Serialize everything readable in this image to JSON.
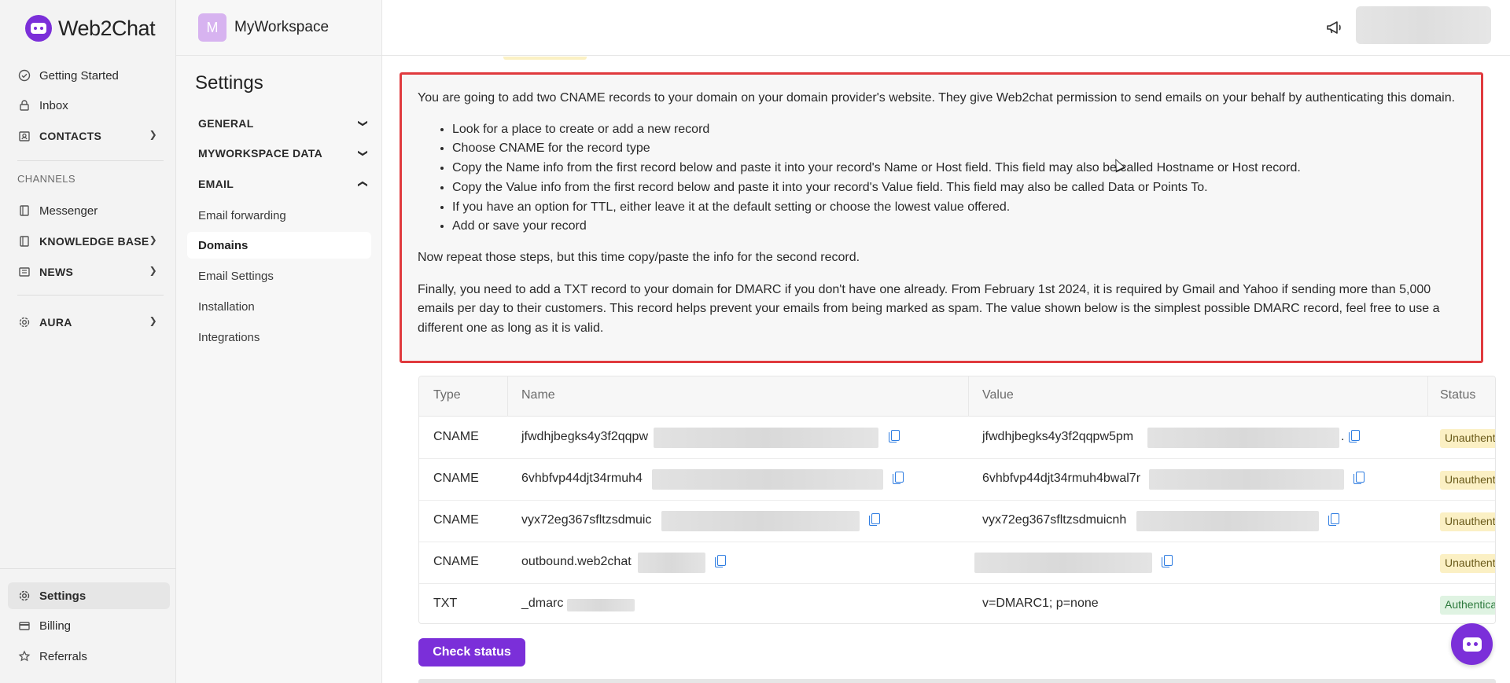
{
  "app": {
    "logo_text": "Web2Chat"
  },
  "leftnav": {
    "items_top": [
      {
        "label": "Getting Started",
        "icon": "check-circle-icon"
      },
      {
        "label": "Inbox",
        "icon": "lock-icon"
      },
      {
        "label": "CONTACTS",
        "icon": "contacts-icon"
      }
    ],
    "channels_label": "CHANNELS",
    "items_channels": [
      {
        "label": "Messenger",
        "icon": "book-icon"
      },
      {
        "label": "KNOWLEDGE BASE",
        "icon": "book-icon"
      },
      {
        "label": "NEWS",
        "icon": "news-icon"
      }
    ],
    "aura": {
      "label": "AURA",
      "icon": "gear-icon"
    },
    "items_bottom": [
      {
        "label": "Settings",
        "icon": "gear-icon"
      },
      {
        "label": "Billing",
        "icon": "card-icon"
      },
      {
        "label": "Referrals",
        "icon": "star-icon"
      }
    ]
  },
  "workspace": {
    "avatar_letter": "M",
    "name": "MyWorkspace"
  },
  "settings": {
    "title": "Settings",
    "groups": [
      {
        "label": "GENERAL"
      },
      {
        "label": "MYWORKSPACE DATA"
      },
      {
        "label": "EMAIL"
      }
    ],
    "email_items": [
      "Email forwarding",
      "Domains",
      "Email Settings"
    ],
    "other_items": [
      "Installation",
      "Integrations"
    ]
  },
  "info": {
    "intro": "You are going to add two CNAME records to your domain on your domain provider's website. They give Web2chat permission to send emails on your behalf by authenticating this domain.",
    "steps": [
      "Look for a place to create or add a new record",
      "Choose CNAME for the record type",
      "Copy the Name info from the first record below and paste it into your record's Name or Host field. This field may also be called Hostname or Host record.",
      "Copy the Value info from the first record below and paste it into your record's Value field. This field may also be called Data or Points To.",
      "If you have an option for TTL, either leave it at the default setting or choose the lowest value offered.",
      "Add or save your record"
    ],
    "repeat": "Now repeat those steps, but this time copy/paste the info for the second record.",
    "dmarc": "Finally, you need to add a TXT record to your domain for DMARC if you don't have one already. From February 1st 2024, it is required by Gmail and Yahoo if sending more than 5,000 emails per day to their customers. This record helps prevent your emails from being marked as spam. The value shown below is the simplest possible DMARC record, feel free to use a different one as long as it is valid."
  },
  "table": {
    "headers": {
      "type": "Type",
      "name": "Name",
      "value": "Value",
      "status": "Status"
    },
    "rows": [
      {
        "type": "CNAME",
        "name": "jfwdhjbegks4y3f2qqpw",
        "value": "jfwdhjbegks4y3f2qqpw5pm",
        "value_tail": ".",
        "status": "Unauthenticated"
      },
      {
        "type": "CNAME",
        "name": "6vhbfvp44djt34rmuh4",
        "value": "6vhbfvp44djt34rmuh4bwal7r",
        "status": "Unauthenticated"
      },
      {
        "type": "CNAME",
        "name": "vyx72eg367sfltzsdmuic",
        "value": "vyx72eg367sfltzsdmuicnh",
        "status": "Unauthenticated"
      },
      {
        "type": "CNAME",
        "name": "outbound.web2chat",
        "value": "",
        "status": "Unauthenticated"
      },
      {
        "type": "TXT",
        "name": "_dmarc",
        "value": "v=DMARC1; p=none",
        "status": "Authenticated"
      }
    ]
  },
  "actions": {
    "check_status": "Check status"
  },
  "colors": {
    "brand": "#7b2fd9",
    "highlight_border": "#e03a3e",
    "copy_icon": "#2f7de1"
  }
}
